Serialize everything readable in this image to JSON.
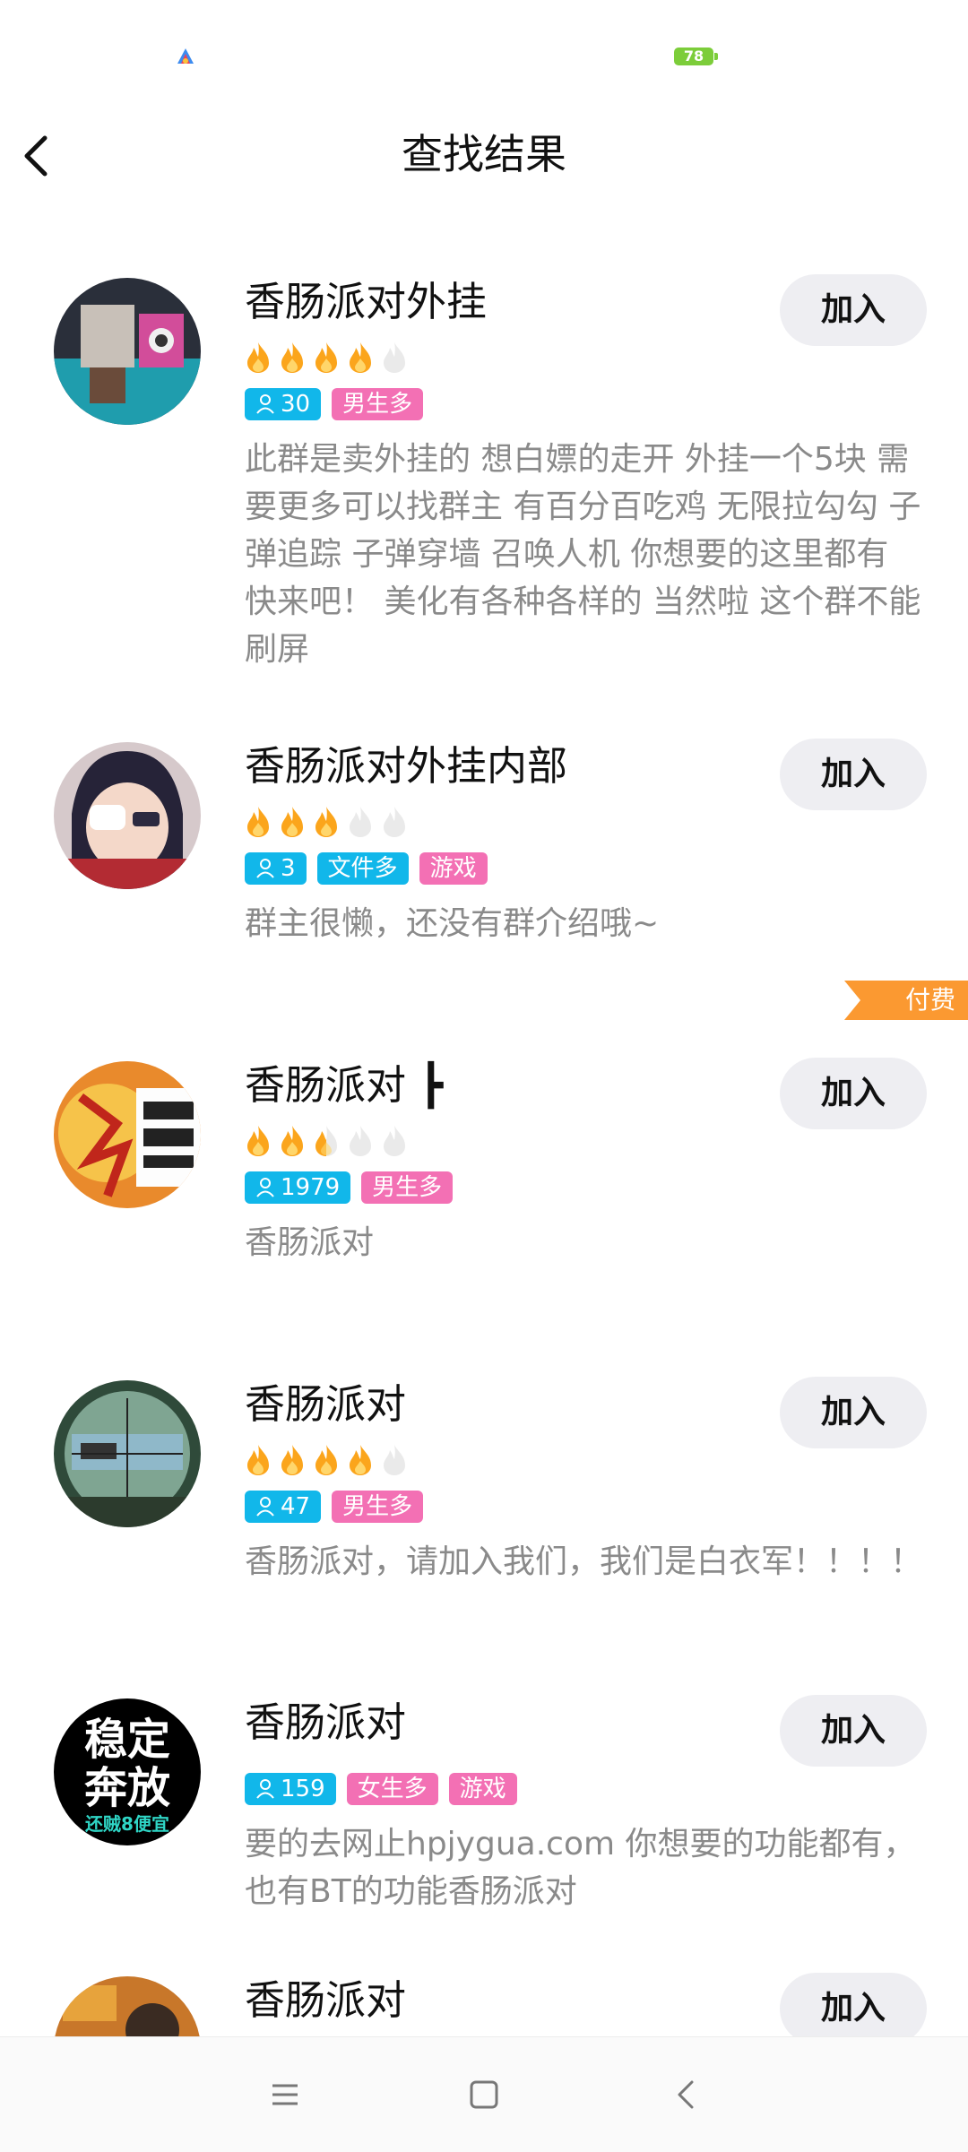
{
  "status_bar": {
    "battery": "78"
  },
  "header": {
    "title": "查找结果"
  },
  "join_label": "加入",
  "groups": [
    {
      "name": "香肠派对外挂",
      "fire_level": 4,
      "members": "30",
      "tags": [
        "男生多"
      ],
      "description": "此群是卖外挂的 想白嫖的走开 外挂一个5块 需要更多可以找群主 有百分百吃鸡 无限拉勾勾 子弹追踪 子弹穿墙 召唤人机 你想要的这里都有 快来吧！ 美化有各种各样的 当然啦 这个群不能刷屏"
    },
    {
      "name": "香肠派对外挂内部",
      "fire_level": 3,
      "members": "3",
      "tags": [
        "文件多",
        "游戏"
      ],
      "description": "群主很懒，还没有群介绍哦~"
    },
    {
      "name": "香肠派对 ┣",
      "fire_level": 2.5,
      "members": "1979",
      "tags": [
        "男生多"
      ],
      "description": "香肠派对",
      "badge": "付费"
    },
    {
      "name": "香肠派对",
      "fire_level": 4,
      "members": "47",
      "tags": [
        "男生多"
      ],
      "description": "香肠派对，请加入我们，我们是白衣军！！！！"
    },
    {
      "name": "香肠派对",
      "members": "159",
      "tags": [
        "女生多",
        "游戏"
      ],
      "description": "要的去网止hpjygua.com 你想要的功能都有，也有BT的功能香肠派对",
      "avatar_text": [
        "稳定",
        "奔放",
        "还贼8便宜"
      ]
    },
    {
      "name": "香肠派对"
    }
  ],
  "colors": {
    "tag_blue": "#11b7ea",
    "tag_pink": "#f370b4",
    "fire_on": "#fba51c",
    "fire_off": "#eaeaea",
    "paid_badge": "#fb9931"
  }
}
